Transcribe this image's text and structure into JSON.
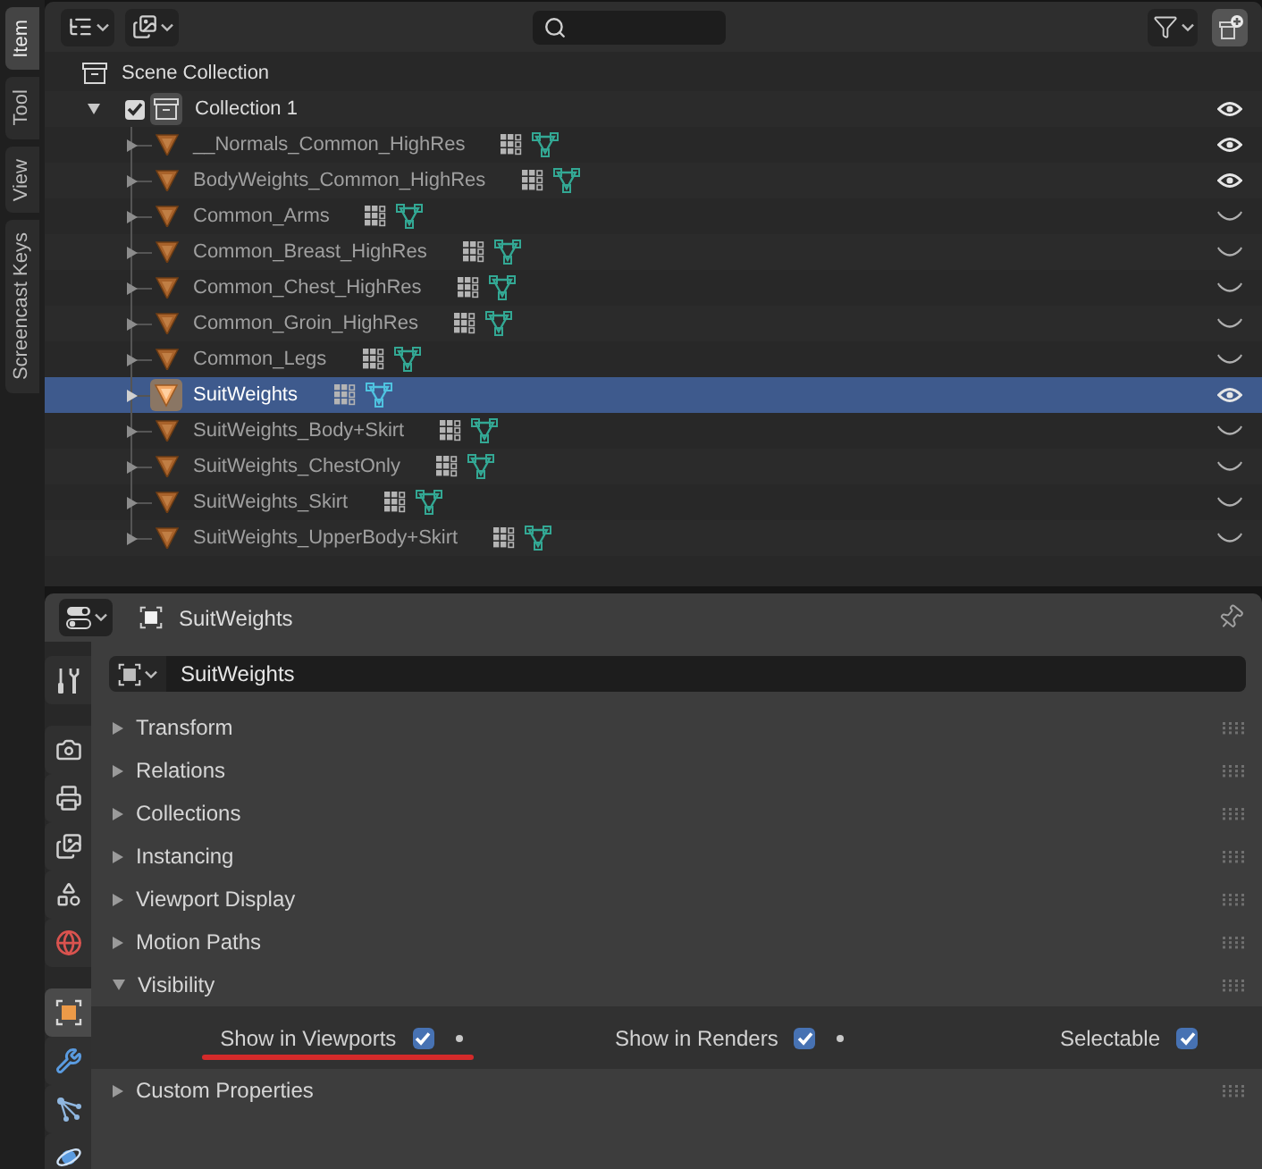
{
  "side_tabs": [
    {
      "label": "Item",
      "selected": true
    },
    {
      "label": "Tool",
      "selected": false
    },
    {
      "label": "View",
      "selected": false
    },
    {
      "label": "Screencast Keys",
      "selected": false
    }
  ],
  "outliner": {
    "tree": [
      {
        "kind": "scene_collection",
        "name": "Scene Collection",
        "selected": false,
        "children": [
          {
            "kind": "collection",
            "name": "Collection 1",
            "expanded": true,
            "checked": true,
            "active": true,
            "visible": true,
            "selected": false,
            "children": [
              {
                "kind": "object",
                "name": "__Normals_Common_HighRes",
                "expanded": false,
                "visible": true,
                "selected": false
              },
              {
                "kind": "object",
                "name": "BodyWeights_Common_HighRes",
                "expanded": false,
                "visible": true,
                "selected": false
              },
              {
                "kind": "object",
                "name": "Common_Arms",
                "expanded": false,
                "visible": false,
                "selected": false
              },
              {
                "kind": "object",
                "name": "Common_Breast_HighRes",
                "expanded": false,
                "visible": false,
                "selected": false
              },
              {
                "kind": "object",
                "name": "Common_Chest_HighRes",
                "expanded": false,
                "visible": false,
                "selected": false
              },
              {
                "kind": "object",
                "name": "Common_Groin_HighRes",
                "expanded": false,
                "visible": false,
                "selected": false
              },
              {
                "kind": "object",
                "name": "Common_Legs",
                "expanded": false,
                "visible": false,
                "selected": false
              },
              {
                "kind": "object",
                "name": "SuitWeights",
                "expanded": false,
                "visible": true,
                "selected": true
              },
              {
                "kind": "object",
                "name": "SuitWeights_Body+Skirt",
                "expanded": false,
                "visible": false,
                "selected": false
              },
              {
                "kind": "object",
                "name": "SuitWeights_ChestOnly",
                "expanded": false,
                "visible": false,
                "selected": false
              },
              {
                "kind": "object",
                "name": "SuitWeights_Skirt",
                "expanded": false,
                "visible": false,
                "selected": false
              },
              {
                "kind": "object",
                "name": "SuitWeights_UpperBody+Skirt",
                "expanded": false,
                "visible": false,
                "selected": false
              }
            ]
          }
        ]
      }
    ]
  },
  "properties": {
    "context": "SuitWeights",
    "tab_groups": [
      [
        {
          "kind": "tool",
          "selected": false
        }
      ],
      [
        {
          "kind": "render",
          "selected": false
        },
        {
          "kind": "output",
          "selected": false
        },
        {
          "kind": "view_layer",
          "selected": false
        },
        {
          "kind": "scene",
          "selected": false
        },
        {
          "kind": "world",
          "selected": false
        }
      ],
      [
        {
          "kind": "object",
          "selected": true
        },
        {
          "kind": "modifiers",
          "selected": false
        },
        {
          "kind": "particles",
          "selected": false
        },
        {
          "kind": "physics",
          "selected": false
        }
      ]
    ],
    "name_field": "SuitWeights",
    "panels": [
      {
        "label": "Transform",
        "expanded": false
      },
      {
        "label": "Relations",
        "expanded": false
      },
      {
        "label": "Collections",
        "expanded": false
      },
      {
        "label": "Instancing",
        "expanded": false
      },
      {
        "label": "Viewport Display",
        "expanded": false
      },
      {
        "label": "Motion Paths",
        "expanded": false
      },
      {
        "label": "Visibility",
        "expanded": true,
        "options": [
          {
            "label": "Show in Viewports",
            "checked": true,
            "keyframe": true,
            "underlined": true
          },
          {
            "label": "Show in Renders",
            "checked": true,
            "keyframe": true,
            "underlined": false
          },
          {
            "label": "Selectable",
            "checked": true,
            "keyframe": false,
            "underlined": false
          }
        ]
      },
      {
        "label": "Custom Properties",
        "expanded": false
      }
    ]
  }
}
